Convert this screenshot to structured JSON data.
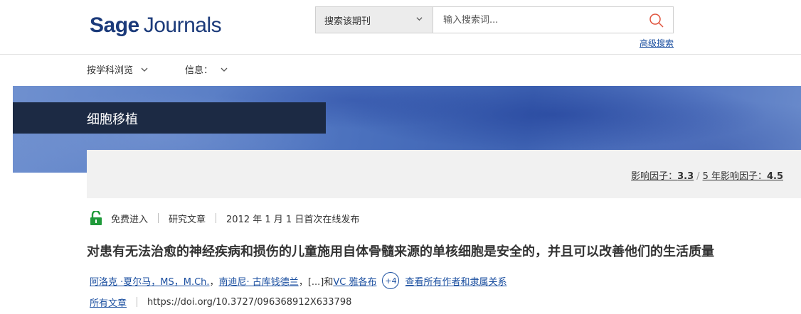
{
  "header": {
    "logo_sage": "Sage",
    "logo_journals": "Journals",
    "search_scope": "搜索该期刊",
    "search_placeholder": "输入搜索词...",
    "advanced_search": "高级搜索"
  },
  "nav": {
    "browse_by_subject": "按学科浏览",
    "info": "信息："
  },
  "journal": {
    "title": "细胞移植",
    "impact_factor_label": "影响因子：",
    "impact_factor_value": "3.3",
    "five_year_label": "5 年影响因子：",
    "five_year_value": "4.5",
    "separator": "/"
  },
  "article": {
    "access": "免费进入",
    "type": "研究文章",
    "published": "2012 年 1 月 1 日首次在线发布",
    "title": "对患有无法治愈的神经疾病和损伤的儿童施用自体骨髓来源的单核细胞是安全的，并且可以改善他们的生活质量",
    "author1": "阿洛克 ·夏尔马，MS，M.Ch.",
    "author_sep": "，",
    "author2": "南迪尼· 古库钱德兰",
    "author_mid": "，[...]和",
    "author3": "VC 雅各布",
    "more_authors": "+4",
    "view_all": "查看所有作者和隶属关系",
    "all_articles": "所有文章",
    "doi": "https://doi.org/10.3727/096368912X633798"
  },
  "colors": {
    "brand": "#1b3a7a",
    "link": "#1b4fa0",
    "banner_stripe": "#1c2a44",
    "lock": "#1f9a3a"
  }
}
